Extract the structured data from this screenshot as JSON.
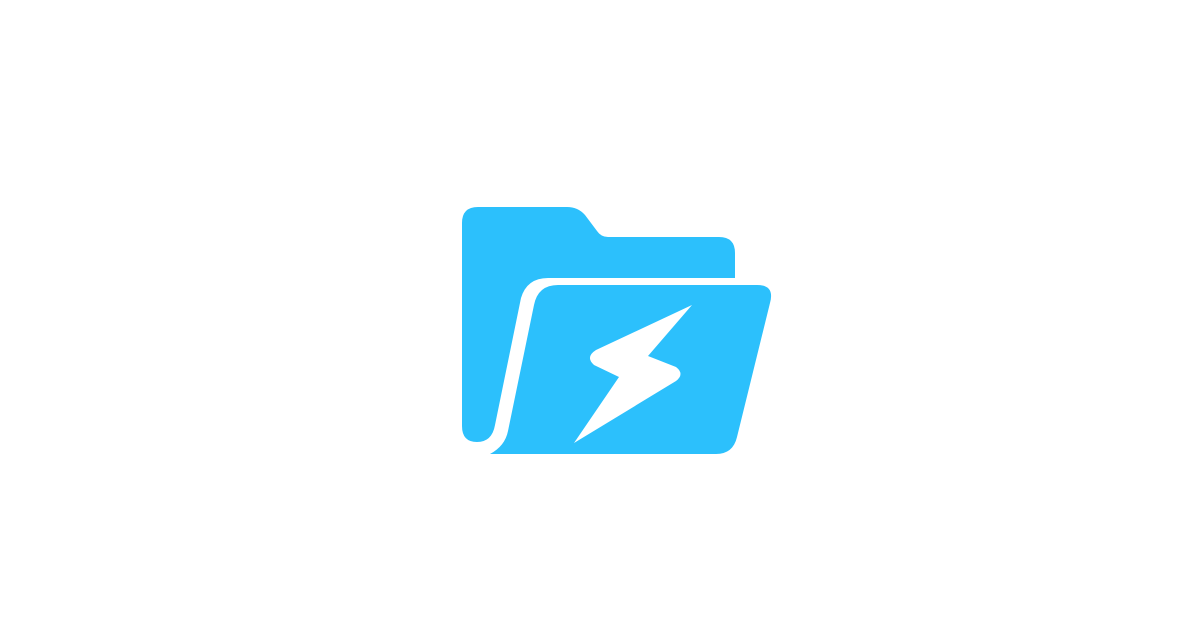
{
  "logo": {
    "icon": "folder-lightning-icon",
    "colors": {
      "background": "#ffffff",
      "folder": "#2cc0fc",
      "bolt": "#ffffff"
    }
  }
}
